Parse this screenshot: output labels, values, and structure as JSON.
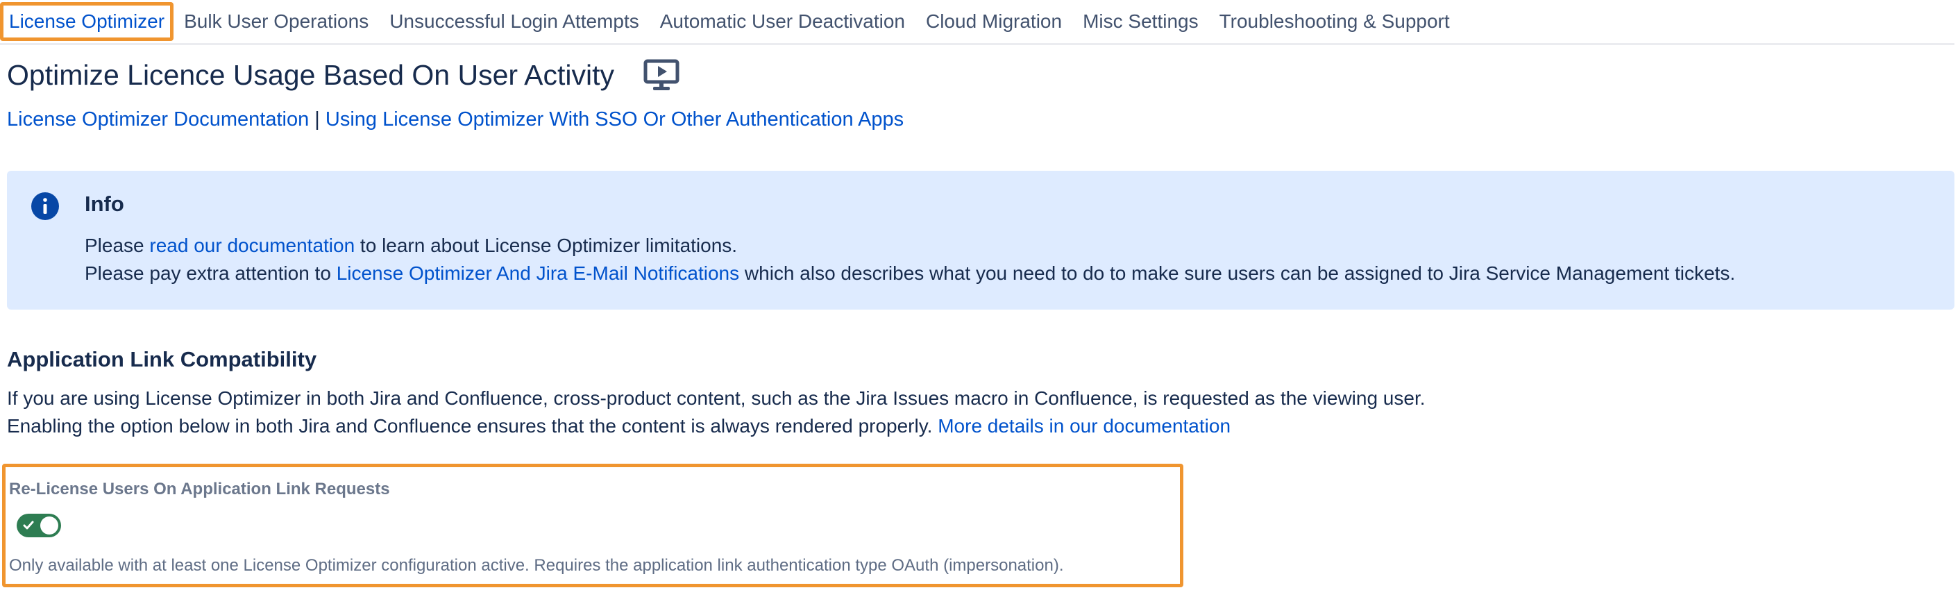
{
  "tabs": [
    {
      "label": "License Optimizer",
      "active": true
    },
    {
      "label": "Bulk User Operations"
    },
    {
      "label": "Unsuccessful Login Attempts"
    },
    {
      "label": "Automatic User Deactivation"
    },
    {
      "label": "Cloud Migration"
    },
    {
      "label": "Misc Settings"
    },
    {
      "label": "Troubleshooting & Support"
    }
  ],
  "header": {
    "title": "Optimize Licence Usage Based On User Activity",
    "icon": "presentation-play-icon"
  },
  "links": {
    "doc": "License Optimizer Documentation",
    "separator": "|",
    "sso": "Using License Optimizer With SSO Or Other Authentication Apps"
  },
  "info": {
    "icon": "info-icon",
    "title": "Info",
    "line1_pre": "Please ",
    "line1_link": "read our documentation",
    "line1_post": " to learn about License Optimizer limitations.",
    "line2_pre": "Please pay extra attention to ",
    "line2_link": "License Optimizer And Jira E-Mail Notifications",
    "line2_post": " which also describes what you need to do to make sure users can be assigned to Jira Service Management tickets."
  },
  "app_link": {
    "title": "Application Link Compatibility",
    "para1": "If you are using License Optimizer in both Jira and Confluence, cross-product content, such as the Jira Issues macro in Confluence, is requested as the viewing user.",
    "para2_pre": "Enabling the option below in both Jira and Confluence ensures that the content is always rendered properly. ",
    "para2_link": "More details in our documentation",
    "setting_label": "Re-License Users On Application Link Requests",
    "toggle_on": true,
    "setting_help": "Only available with at least one License Optimizer configuration active. Requires the application link authentication type OAuth (impersonation)."
  },
  "colors": {
    "link": "#0052cc",
    "highlight": "#f0952f",
    "info_bg": "#deebff",
    "toggle_on": "#2e7d52"
  }
}
